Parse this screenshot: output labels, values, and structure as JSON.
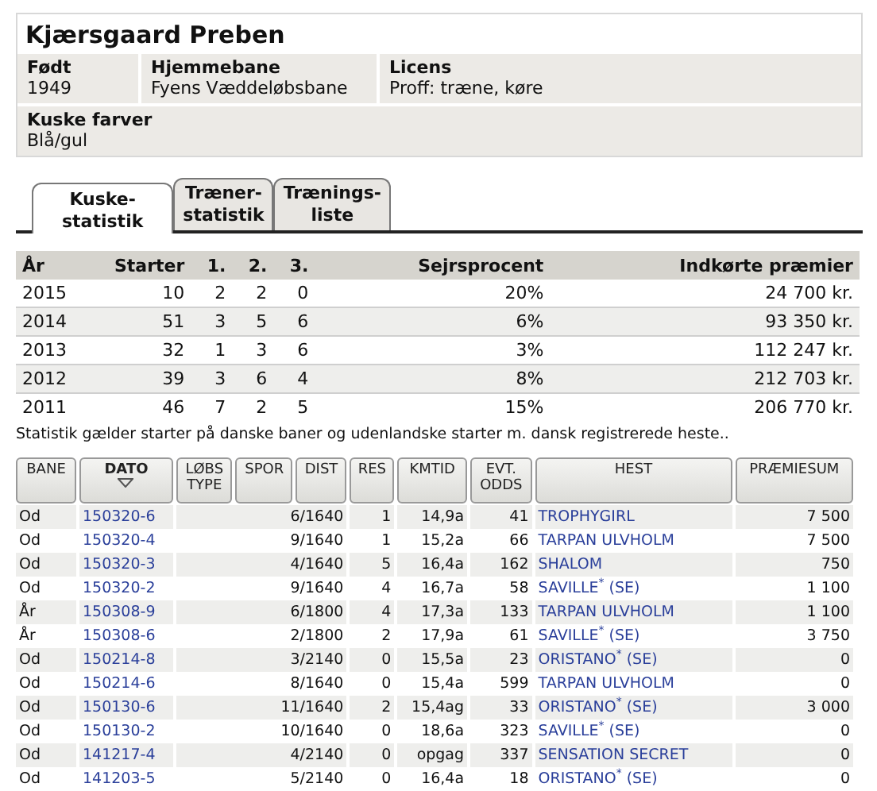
{
  "profile": {
    "name": "Kjærsgaard Preben",
    "fields": [
      {
        "label": "Født",
        "value": "1949"
      },
      {
        "label": "Hjemmebane",
        "value": "Fyens Væddeløbsbane"
      },
      {
        "label": "Licens",
        "value": "Proff: træne, køre"
      }
    ],
    "colors": {
      "label": "Kuske farver",
      "value": "Blå/gul"
    }
  },
  "tabs": [
    {
      "label": "Kuske-\nstatistik",
      "selected": true
    },
    {
      "label": "Træner-\nstatistik",
      "selected": false
    },
    {
      "label": "Trænings-\nliste",
      "selected": false
    }
  ],
  "stats": {
    "columns": [
      "År",
      "Starter",
      "1.",
      "2.",
      "3.",
      "Sejrsprocent",
      "Indkørte præmier"
    ],
    "rows": [
      [
        "2015",
        "10",
        "2",
        "2",
        "0",
        "20%",
        "24 700 kr."
      ],
      [
        "2014",
        "51",
        "3",
        "5",
        "6",
        "6%",
        "93 350 kr."
      ],
      [
        "2013",
        "32",
        "1",
        "3",
        "6",
        "3%",
        "112 247 kr."
      ],
      [
        "2012",
        "39",
        "3",
        "6",
        "4",
        "8%",
        "212 703 kr."
      ],
      [
        "2011",
        "46",
        "7",
        "2",
        "5",
        "15%",
        "206 770 kr."
      ]
    ],
    "note": "Statistik gælder starter på danske baner og udenlandske starter m. dansk registrerede heste.."
  },
  "starts": {
    "columns": [
      {
        "label": "BANE",
        "sorted": false
      },
      {
        "label": "DATO",
        "sorted": true
      },
      {
        "label": "LØBS\nTYPE",
        "sorted": false
      },
      {
        "label": "SPOR",
        "sorted": false
      },
      {
        "label": "DIST",
        "sorted": false
      },
      {
        "label": "RES",
        "sorted": false
      },
      {
        "label": "KMTID",
        "sorted": false
      },
      {
        "label": "EVT.\nODDS",
        "sorted": false
      },
      {
        "label": "HEST",
        "sorted": false
      },
      {
        "label": "PRÆMIESUM",
        "sorted": false
      }
    ],
    "rows": [
      {
        "bane": "Od",
        "dato": "150320-6",
        "dist": "6/1640",
        "res": "1",
        "kmtid": "14,9a",
        "odds": "41",
        "hest": "TROPHYGIRL",
        "praemie": "7 500"
      },
      {
        "bane": "Od",
        "dato": "150320-4",
        "dist": "9/1640",
        "res": "1",
        "kmtid": "15,2a",
        "odds": "66",
        "hest": "TARPAN ULVHOLM",
        "praemie": "7 500"
      },
      {
        "bane": "Od",
        "dato": "150320-3",
        "dist": "4/1640",
        "res": "5",
        "kmtid": "16,4a",
        "odds": "162",
        "hest": "SHALOM",
        "praemie": "750"
      },
      {
        "bane": "Od",
        "dato": "150320-2",
        "dist": "9/1640",
        "res": "4",
        "kmtid": "16,7a",
        "odds": "58",
        "hest": "SAVILLE$^{*}$ (SE)",
        "praemie": "1 100"
      },
      {
        "bane": "År",
        "dato": "150308-9",
        "dist": "6/1800",
        "res": "4",
        "kmtid": "17,3a",
        "odds": "133",
        "hest": "TARPAN ULVHOLM",
        "praemie": "1 100"
      },
      {
        "bane": "År",
        "dato": "150308-6",
        "dist": "2/1800",
        "res": "2",
        "kmtid": "17,9a",
        "odds": "61",
        "hest": "SAVILLE$^{*}$ (SE)",
        "praemie": "3 750"
      },
      {
        "bane": "Od",
        "dato": "150214-8",
        "dist": "3/2140",
        "res": "0",
        "kmtid": "15,5a",
        "odds": "23",
        "hest": "ORISTANO$^{*}$ (SE)",
        "praemie": "0"
      },
      {
        "bane": "Od",
        "dato": "150214-6",
        "dist": "8/1640",
        "res": "0",
        "kmtid": "15,4a",
        "odds": "599",
        "hest": "TARPAN ULVHOLM",
        "praemie": "0"
      },
      {
        "bane": "Od",
        "dato": "150130-6",
        "dist": "11/1640",
        "res": "2",
        "kmtid": "15,4ag",
        "odds": "33",
        "hest": "ORISTANO$^{*}$ (SE)",
        "praemie": "3 000"
      },
      {
        "bane": "Od",
        "dato": "150130-2",
        "dist": "10/1640",
        "res": "0",
        "kmtid": "18,6a",
        "odds": "323",
        "hest": "SAVILLE$^{*}$ (SE)",
        "praemie": "0"
      },
      {
        "bane": "Od",
        "dato": "141217-4",
        "dist": "4/2140",
        "res": "0",
        "kmtid": "opgag",
        "odds": "337",
        "hest": "SENSATION SECRET",
        "praemie": "0"
      },
      {
        "bane": "Od",
        "dato": "141203-5",
        "dist": "5/2140",
        "res": "0",
        "kmtid": "16,4a",
        "odds": "18",
        "hest": "ORISTANO$^{*}$ (SE)",
        "praemie": "0"
      }
    ]
  }
}
